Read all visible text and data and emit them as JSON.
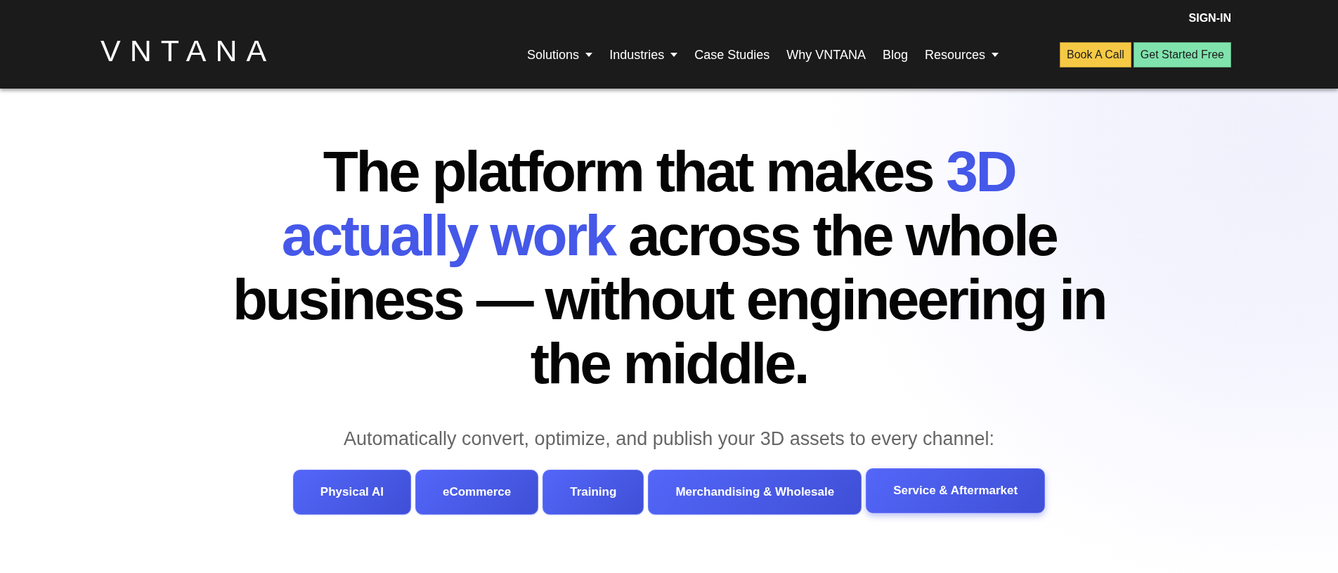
{
  "header": {
    "logo": "VNTANA",
    "sign_in": "SIGN-IN",
    "nav": [
      {
        "label": "Solutions",
        "dropdown": true
      },
      {
        "label": "Industries",
        "dropdown": true
      },
      {
        "label": "Case Studies",
        "dropdown": false
      },
      {
        "label": "Why VNTANA",
        "dropdown": false
      },
      {
        "label": "Blog",
        "dropdown": false
      },
      {
        "label": "Resources",
        "dropdown": true
      }
    ],
    "buttons": [
      {
        "label": "Book A Call",
        "color": "#f6c945"
      },
      {
        "label": "Get Started Free",
        "color": "#80e3ad"
      }
    ]
  },
  "hero": {
    "heading": [
      {
        "text": "The platform that makes ",
        "highlight": false
      },
      {
        "text": "3D actually work",
        "highlight": true
      },
      {
        "text": " across the whole business — without engineering in the middle.",
        "highlight": false
      }
    ],
    "subtitle": "Automatically convert, optimize, and publish your 3D assets to every channel:",
    "channels": [
      {
        "label": "Physical AI",
        "hovered": false
      },
      {
        "label": "eCommerce",
        "hovered": false
      },
      {
        "label": "Training",
        "hovered": false
      },
      {
        "label": "Merchandising & Wholesale",
        "hovered": false
      },
      {
        "label": "Service & Aftermarket",
        "hovered": true
      }
    ]
  }
}
